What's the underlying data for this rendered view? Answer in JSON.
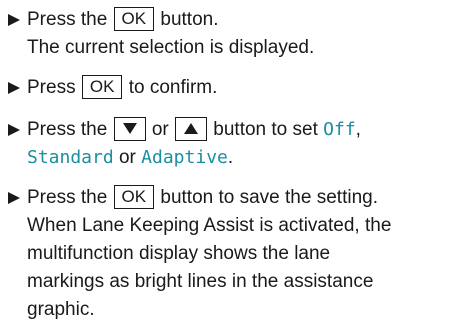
{
  "steps": [
    {
      "pre": "Press the",
      "key": "OK",
      "post": "button.",
      "result": "The current selection is displayed."
    },
    {
      "pre": "Press",
      "key": "OK",
      "post": "to confirm."
    },
    {
      "pre": "Press the",
      "key_down_icon": "down-arrow-icon",
      "mid": "or",
      "key_up_icon": "up-arrow-icon",
      "post": "button to set",
      "option_off": "Off",
      "sep1": ",",
      "option_standard": "Standard",
      "or_word": "or",
      "option_adaptive": "Adaptive",
      "end": "."
    },
    {
      "pre": "Press the",
      "key": "OK",
      "post": "button to save the setting.",
      "result_lines": [
        "When Lane Keeping Assist is activated, the",
        "multifunction display shows the lane",
        "markings as bright lines in the assistance",
        "graphic."
      ]
    }
  ],
  "colors": {
    "text": "#1a1a1a",
    "option_highlight": "#1a8fa0"
  }
}
